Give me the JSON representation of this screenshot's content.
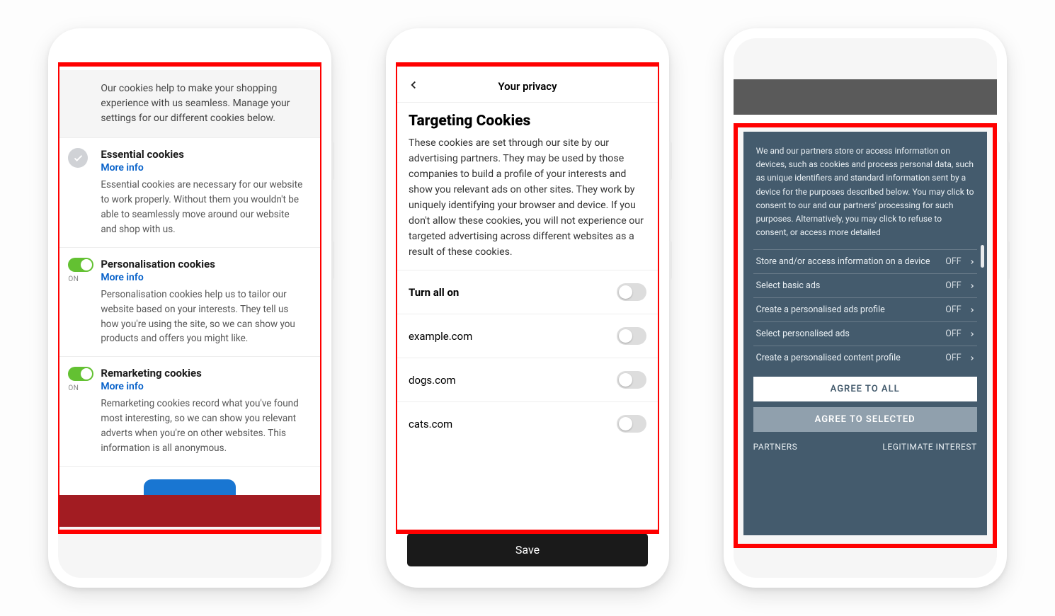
{
  "phone1": {
    "intro": "Our cookies help to make your shopping experience with us seamless. Manage your settings for our different cookies below.",
    "more_info_label": "More info",
    "sections": [
      {
        "title": "Essential cookies",
        "desc": "Essential cookies are necessary for our website to work properly. Without them you wouldn't be able to seamlessly move around our website and shop with us."
      },
      {
        "title": "Personalisation cookies",
        "on_label": "ON",
        "desc": "Personalisation cookies help us to tailor our website based on your interests. They tell us how you're using the site, so we can show you products and offers you might like."
      },
      {
        "title": "Remarketing cookies",
        "on_label": "ON",
        "desc": "Remarketing cookies record what you've found most interesting, so we can show you relevant adverts when you're on other websites. This information is all anonymous."
      }
    ]
  },
  "phone2": {
    "header": "Your privacy",
    "title": "Targeting Cookies",
    "description": "These cookies are set through our site by our advertising partners. They may be used by those companies to build a profile of your interests and show you relevant ads on other sites. They work by uniquely identifying your browser and device. If you don't allow these cookies, you will not experience our targeted advertising across different websites as a result of these cookies.",
    "rows": [
      {
        "label": "Turn all on",
        "strong": true
      },
      {
        "label": "example.com",
        "strong": false
      },
      {
        "label": "dogs.com",
        "strong": false
      },
      {
        "label": "cats.com",
        "strong": false
      }
    ],
    "save": "Save"
  },
  "phone3": {
    "intro": "We and our partners store or access information on devices, such as cookies and process personal data, such as unique identifiers and standard information sent by a device for the purposes described below. You may click to consent to our and our partners' processing for such purposes. Alternatively, you may click to refuse to consent, or access more detailed",
    "items": [
      {
        "label": "Store and/or access information on a device",
        "state": "OFF"
      },
      {
        "label": "Select basic ads",
        "state": "OFF"
      },
      {
        "label": "Create a personalised ads profile",
        "state": "OFF"
      },
      {
        "label": "Select personalised ads",
        "state": "OFF"
      },
      {
        "label": "Create a personalised content profile",
        "state": "OFF"
      }
    ],
    "agree_all": "AGREE TO ALL",
    "agree_selected": "AGREE TO SELECTED",
    "partners": "PARTNERS",
    "legit": "LEGITIMATE INTEREST"
  }
}
